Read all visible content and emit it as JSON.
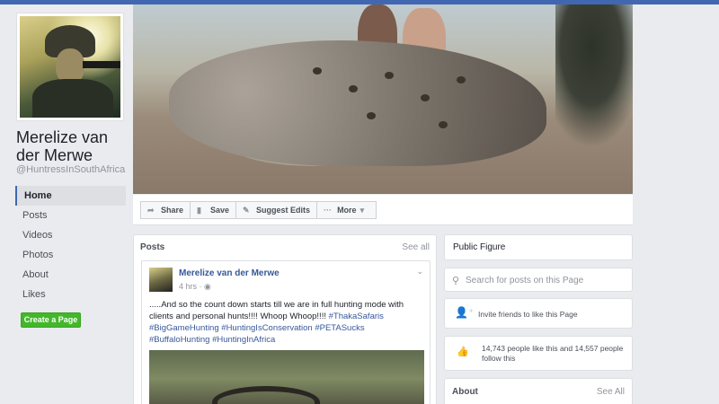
{
  "profile": {
    "name": "Merelize van der Merwe",
    "handle": "@HuntressInSouthAfrica"
  },
  "left_nav": {
    "items": [
      {
        "label": "Home",
        "active": true
      },
      {
        "label": "Posts"
      },
      {
        "label": "Videos"
      },
      {
        "label": "Photos"
      },
      {
        "label": "About"
      },
      {
        "label": "Likes"
      }
    ],
    "create_page_label": "Create a Page"
  },
  "actions": {
    "share": "Share",
    "save": "Save",
    "suggest_edits": "Suggest Edits",
    "more": "More"
  },
  "posts_panel": {
    "title": "Posts",
    "see_all": "See all",
    "post": {
      "author": "Merelize van der Merwe",
      "time": "4 hrs",
      "text_plain": ".....And so the count down starts till we are in full hunting mode with clients and personal hunts!!!! Whoop Whoop!!!! ",
      "tags": [
        "#ThakaSafaris",
        "#BigGameHunting",
        "#HuntingIsConservation",
        "#PETASucks",
        "#BuffaloHunting",
        "#HuntingInAfrica"
      ]
    }
  },
  "right": {
    "category": "Public Figure",
    "search_placeholder": "Search for posts on this Page",
    "invite": "Invite friends to like this Page",
    "likes": "14,743 people like this and 14,557 people follow this",
    "about_title": "About",
    "about_see_all": "See All"
  },
  "colors": {
    "brand_blue": "#4267b2",
    "link_blue": "#365899",
    "create_green": "#42b72a",
    "background": "#e9ebee"
  },
  "icons": [
    "share-icon",
    "bookmark-icon",
    "pencil-icon",
    "dots-icon",
    "chevron-down-icon",
    "globe-icon",
    "search-icon",
    "add-person-icon",
    "thumbs-up-icon"
  ]
}
